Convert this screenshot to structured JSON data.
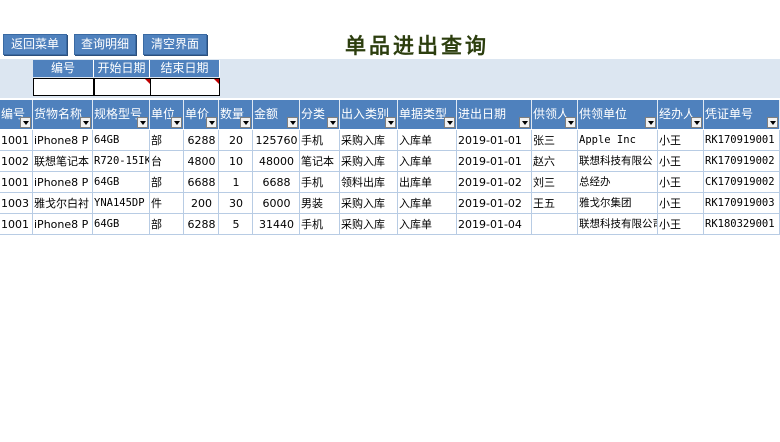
{
  "toolbar": {
    "back_label": "返回菜单",
    "detail_label": "查询明细",
    "clear_label": "清空界面"
  },
  "page_title": "单品进出查询",
  "filters": {
    "code_label": "编号",
    "start_label": "开始日期",
    "end_label": "结束日期",
    "code_value": "",
    "start_value": "",
    "end_value": ""
  },
  "table": {
    "headers": [
      "编号",
      "货物名称",
      "规格型号",
      "单位",
      "单价",
      "数量",
      "金额",
      "分类",
      "出入类别",
      "单据类型",
      "进出日期",
      "供领人",
      "供领单位",
      "经办人",
      "凭证单号"
    ],
    "rows": [
      [
        "1001",
        "iPhone8 P",
        "64GB",
        "部",
        "6288",
        "20",
        "125760",
        "手机",
        "采购入库",
        "入库单",
        "2019-01-01",
        "张三",
        "Apple Inc",
        "小王",
        "RK170919001"
      ],
      [
        "1002",
        "联想笔记本",
        "R720-15IK",
        "台",
        "4800",
        "10",
        "48000",
        "笔记本",
        "采购入库",
        "入库单",
        "2019-01-01",
        "赵六",
        "联想科技有限公",
        "小王",
        "RK170919002"
      ],
      [
        "1001",
        "iPhone8 P",
        "64GB",
        "部",
        "6688",
        "1",
        "6688",
        "手机",
        "领料出库",
        "出库单",
        "2019-01-02",
        "刘三",
        "总经办",
        "小王",
        "CK170919002"
      ],
      [
        "1003",
        "雅戈尔白衬",
        "YNA145DP",
        "件",
        "200",
        "30",
        "6000",
        "男装",
        "采购入库",
        "入库单",
        "2019-01-02",
        "王五",
        "雅戈尔集团",
        "小王",
        "RK170919003"
      ],
      [
        "1001",
        "iPhone8 P",
        "64GB",
        "部",
        "6288",
        "5",
        "31440",
        "手机",
        "采购入库",
        "入库单",
        "2019-01-04",
        "",
        "联想科技有限公司",
        "小王",
        "RK180329001"
      ]
    ]
  }
}
